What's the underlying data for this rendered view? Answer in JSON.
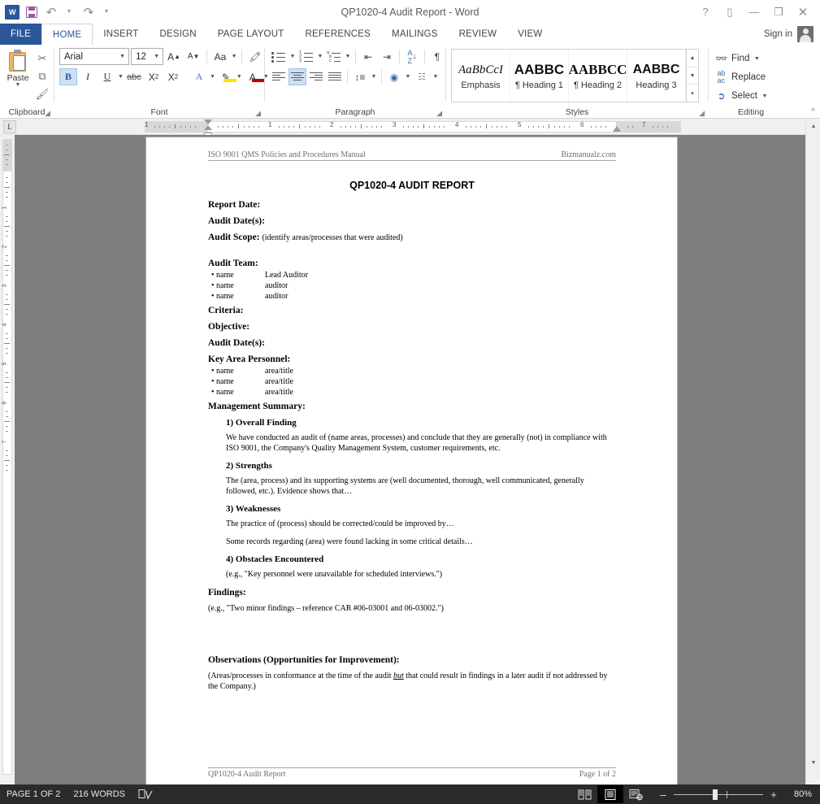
{
  "window": {
    "title": "QP1020-4 Audit Report - Word",
    "help_icon": "?",
    "ribbon_display_icon": "ribbon-display-options",
    "minimize_icon": "—",
    "maximize_icon": "❐",
    "close_icon": "✕",
    "app_logo_label": "W"
  },
  "quick_access": {
    "save_label": "Save",
    "undo_label": "Undo",
    "redo_label": "Redo",
    "customize_label": "Customize Quick Access Toolbar"
  },
  "tabs": [
    {
      "label": "FILE",
      "active": false
    },
    {
      "label": "HOME",
      "active": true
    },
    {
      "label": "INSERT",
      "active": false
    },
    {
      "label": "DESIGN",
      "active": false
    },
    {
      "label": "PAGE LAYOUT",
      "active": false
    },
    {
      "label": "REFERENCES",
      "active": false
    },
    {
      "label": "MAILINGS",
      "active": false
    },
    {
      "label": "REVIEW",
      "active": false
    },
    {
      "label": "VIEW",
      "active": false
    }
  ],
  "account": {
    "sign_in_label": "Sign in"
  },
  "ribbon": {
    "clipboard": {
      "group_label": "Clipboard",
      "paste_label": "Paste",
      "cut_label": "Cut",
      "copy_label": "Copy",
      "format_painter_label": "Format Painter"
    },
    "font": {
      "group_label": "Font",
      "font_name": "Arial",
      "font_size": "12",
      "grow_font_label": "A",
      "shrink_font_label": "A",
      "change_case_label": "Aa",
      "clear_formatting_label": "Clear All Formatting",
      "bold_label": "B",
      "italic_label": "I",
      "underline_label": "U",
      "strikethrough_label": "abc",
      "subscript_label": "X",
      "superscript_label": "X",
      "text_effects_label": "A",
      "highlight_label": "Text Highlight Color",
      "font_color_label": "A",
      "bold_active": true
    },
    "paragraph": {
      "group_label": "Paragraph",
      "bullets_label": "Bullets",
      "numbering_label": "Numbering",
      "multilevel_label": "Multilevel List",
      "decrease_indent_label": "Decrease Indent",
      "increase_indent_label": "Increase Indent",
      "sort_label": "Sort",
      "show_marks_label": "¶",
      "align_left_label": "Align Left",
      "align_center_label": "Center",
      "align_right_label": "Align Right",
      "justify_label": "Justify",
      "line_spacing_label": "Line and Paragraph Spacing",
      "shading_label": "Shading",
      "borders_label": "Borders",
      "center_active": true
    },
    "styles": {
      "group_label": "Styles",
      "items": [
        {
          "preview": "AaBbCcI",
          "name": "Emphasis"
        },
        {
          "preview": "AABBC",
          "name": "¶ Heading 1"
        },
        {
          "preview": "AABBCС",
          "name": "¶ Heading 2"
        },
        {
          "preview": "AABBC",
          "name": "Heading 3"
        }
      ],
      "scroll_up_label": "▲",
      "scroll_down_label": "▼",
      "more_label": "≡"
    },
    "editing": {
      "group_label": "Editing",
      "find_label": "Find",
      "replace_label": "Replace",
      "select_label": "Select"
    },
    "collapse_label": "Collapse the Ribbon"
  },
  "ruler": {
    "tab_selector_label": "L",
    "horizontal_ticks": [
      "1",
      "1",
      "2",
      "3",
      "4",
      "5",
      "6",
      "7"
    ],
    "vertical_ticks": [
      "1",
      "2",
      "3",
      "4",
      "5",
      "6",
      "7"
    ]
  },
  "document": {
    "header": {
      "left": "ISO 9001 QMS Policies and Procedures Manual",
      "right": "Bizmanualz.com"
    },
    "title": "QP1020-4 AUDIT REPORT",
    "fields": [
      {
        "label": "Report Date:",
        "hint": ""
      },
      {
        "label": "Audit Date(s):",
        "hint": ""
      },
      {
        "label": "Audit Scope:",
        "hint": "(identify areas/processes that were audited)"
      }
    ],
    "audit_team": {
      "label": "Audit Team:",
      "rows": [
        {
          "name": "name",
          "role": "Lead Auditor"
        },
        {
          "name": "name",
          "role": "auditor"
        },
        {
          "name": "name",
          "role": "auditor"
        }
      ]
    },
    "fields2": [
      {
        "label": "Criteria:"
      },
      {
        "label": "Objective:"
      },
      {
        "label": "Audit Date(s):"
      }
    ],
    "key_area_personnel": {
      "label": "Key Area Personnel:",
      "rows": [
        {
          "name": "name",
          "role": "area/title"
        },
        {
          "name": "name",
          "role": "area/title"
        },
        {
          "name": "name",
          "role": "area/title"
        }
      ]
    },
    "management_summary": {
      "label": "Management Summary:",
      "sections": [
        {
          "heading": "1) Overall Finding",
          "paragraphs": [
            "We have conducted an audit of (name areas, processes) and conclude that they are generally (not) in compliance with ISO 9001, the Company's Quality Management System, customer requirements, etc."
          ]
        },
        {
          "heading": "2) Strengths",
          "paragraphs": [
            "The (area, process) and its supporting systems are (well documented, thorough, well communicated, generally followed, etc.).  Evidence shows that…"
          ]
        },
        {
          "heading": "3) Weaknesses",
          "paragraphs": [
            "The practice of (process) should be corrected/could be improved by…",
            "Some records regarding (area) were found lacking in some critical details…"
          ]
        },
        {
          "heading": "4) Obstacles Encountered",
          "paragraphs": [
            "(e.g., \"Key personnel were unavailable for scheduled interviews.\")"
          ]
        }
      ]
    },
    "findings": {
      "label": "Findings:",
      "text": "(e.g., \"Two minor findings – reference CAR #06-03001 and 06-03002.\")"
    },
    "observations": {
      "label": "Observations (Opportunities for Improvement):",
      "text_before": "(Areas/processes in conformance at the time of the audit ",
      "emphasis": "but",
      "text_after": " that could result in findings in a later audit if not addressed by the Company.)"
    },
    "footer": {
      "left": "QP1020-4 Audit Report",
      "right": "Page 1 of 2"
    }
  },
  "status_bar": {
    "page_indicator": "PAGE 1 OF 2",
    "word_count": "216 WORDS",
    "proofing_label": "Proofing errors",
    "views": [
      {
        "name": "read-mode",
        "active": false
      },
      {
        "name": "print-layout",
        "active": true
      },
      {
        "name": "web-layout",
        "active": false
      }
    ],
    "zoom_out_label": "–",
    "zoom_in_label": "+",
    "zoom_level": "80%"
  }
}
